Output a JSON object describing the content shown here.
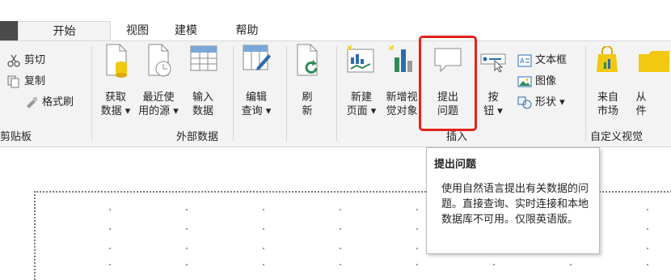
{
  "tabs": [
    {
      "label": "开始"
    },
    {
      "label": "视图"
    },
    {
      "label": "建模"
    },
    {
      "label": "帮助"
    }
  ],
  "clipboard": {
    "cut": "剪切",
    "copy": "复制",
    "format_painter": "格式刷",
    "group_label": "剪贴板"
  },
  "external_data": {
    "get_data": [
      "获取",
      "数据 ▾"
    ],
    "recent_sources": [
      "最近使",
      "用的源 ▾"
    ],
    "enter_data": [
      "输入",
      "数据"
    ],
    "edit_queries": [
      "编辑",
      "查询 ▾"
    ],
    "refresh": [
      "刷",
      "新"
    ],
    "group_label": "外部数据"
  },
  "insert": {
    "new_page": [
      "新建",
      "页面 ▾"
    ],
    "new_visual": [
      "新增视",
      "觉对象"
    ],
    "ask_question": [
      "提出",
      "问题"
    ],
    "buttons": [
      "按",
      "钮 ▾"
    ],
    "text_box": "文本框",
    "image": "图像",
    "shapes": "形状 ▾",
    "group_label": "插入"
  },
  "custom_visuals": {
    "from_marketplace": [
      "来自",
      "市场"
    ],
    "from_file": [
      "从",
      "件"
    ],
    "group_label": "自定义视觉"
  },
  "tooltip": {
    "title": "提出问题",
    "body": "使用自然语言提出有关数据的问题。直接查询、实时连接和本地数据库不可用。仅限英语版。"
  },
  "colors": {
    "highlight": "#e3221b",
    "ribbon_bg": "#f3f3f3",
    "accent_yellow": "#f2c811"
  }
}
